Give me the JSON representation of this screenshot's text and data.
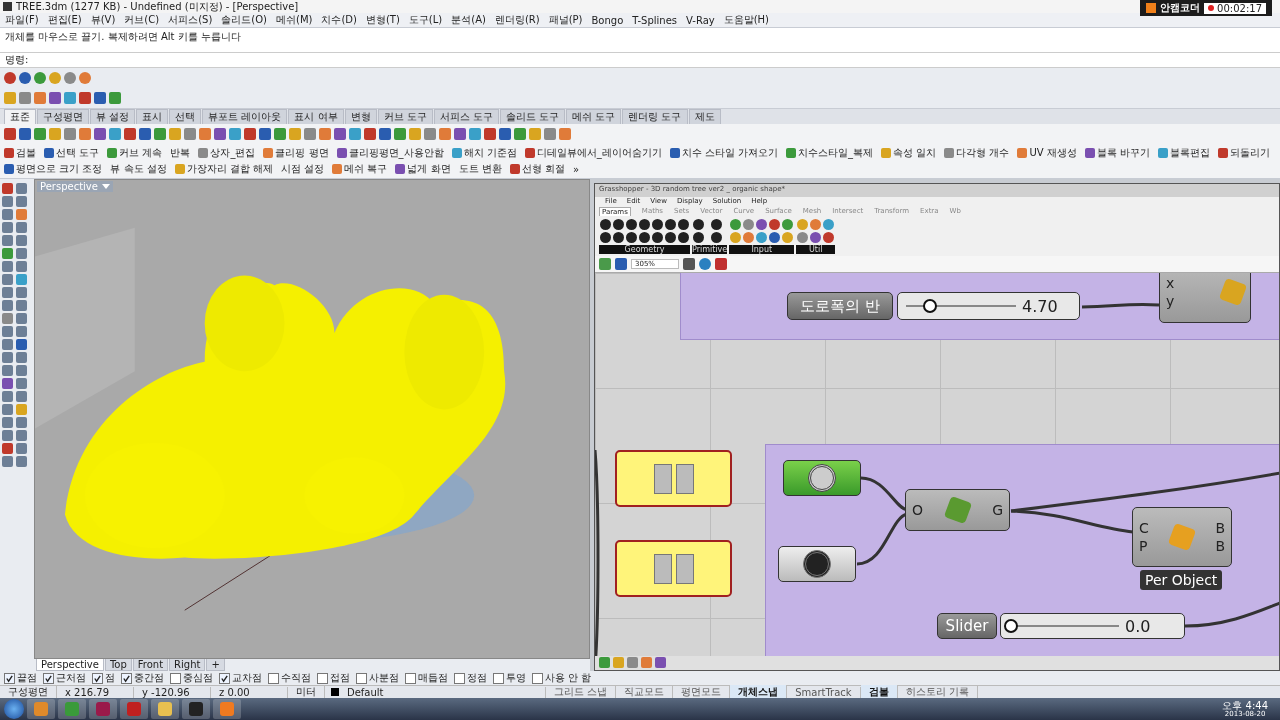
{
  "window": {
    "title": "TREE.3dm (1277 KB) - Undefined (미지정) - [Perspective]"
  },
  "recorder": {
    "name": "안캠코더",
    "time": "00:02:17"
  },
  "menu": [
    "파일(F)",
    "편집(E)",
    "뷰(V)",
    "커브(C)",
    "서피스(S)",
    "솔리드(O)",
    "메쉬(M)",
    "치수(D)",
    "변형(T)",
    "도구(L)",
    "분석(A)",
    "렌더링(R)",
    "패널(P)",
    "Bongo",
    "T-Splines",
    "V-Ray",
    "도움말(H)"
  ],
  "command": {
    "history": "개체를 마우스로 끌기. 복제하려면 Alt 키를 누릅니다",
    "prompt": "명령:"
  },
  "toolbar_tabs": [
    {
      "label": "표준",
      "selected": true
    },
    {
      "label": "구성평면",
      "selected": false
    },
    {
      "label": "뷰 설정",
      "selected": false
    },
    {
      "label": "표시",
      "selected": false
    },
    {
      "label": "선택",
      "selected": false
    },
    {
      "label": "뷰포트 레이아웃",
      "selected": false
    },
    {
      "label": "표시 여부",
      "selected": false
    },
    {
      "label": "변형",
      "selected": false
    },
    {
      "label": "커브 도구",
      "selected": false
    },
    {
      "label": "서피스 도구",
      "selected": false
    },
    {
      "label": "솔리드 도구",
      "selected": false
    },
    {
      "label": "메쉬 도구",
      "selected": false
    },
    {
      "label": "렌더링 도구",
      "selected": false
    },
    {
      "label": "제도",
      "selected": false
    }
  ],
  "tool_buttons": [
    {
      "label": "검볼",
      "icon": true
    },
    {
      "label": "선택 도구",
      "icon": true
    },
    {
      "label": "커브 계속",
      "icon": true
    },
    {
      "label": "반복",
      "icon": false
    },
    {
      "label": "상자_편집",
      "icon": true
    },
    {
      "label": "클리핑 평면",
      "icon": true
    },
    {
      "label": "클리핑평면_사용안함",
      "icon": true
    },
    {
      "label": "해치 기준점",
      "icon": true
    },
    {
      "label": "디테일뷰에서_레이어숨기기",
      "icon": true
    },
    {
      "label": "치수 스타일 가져오기",
      "icon": true
    },
    {
      "label": "치수스타일_복제",
      "icon": true
    },
    {
      "label": "속성 일치",
      "icon": true
    },
    {
      "label": "다각형 개수",
      "icon": true
    },
    {
      "label": "UV 재생성",
      "icon": true
    },
    {
      "label": "블록 바꾸기",
      "icon": true
    },
    {
      "label": "블록편집",
      "icon": true
    },
    {
      "label": "되돌리기",
      "icon": true
    },
    {
      "label": "평면으로 크기 조정",
      "icon": true
    },
    {
      "label": "뷰 속도 설정",
      "icon": false
    },
    {
      "label": "가장자리 결합 해제",
      "icon": true
    },
    {
      "label": "시점 설정",
      "icon": false
    },
    {
      "label": "메쉬 복구",
      "icon": true
    },
    {
      "label": "넓게 화면",
      "icon": true
    },
    {
      "label": "도트 변환",
      "icon": false
    },
    {
      "label": "선형 회절",
      "icon": true
    },
    {
      "label": "»",
      "icon": false
    }
  ],
  "viewport": {
    "label": "Perspective",
    "tabs": [
      {
        "label": "Perspective",
        "selected": true
      },
      {
        "label": "Top",
        "selected": false
      },
      {
        "label": "Front",
        "selected": false
      },
      {
        "label": "Right",
        "selected": false
      },
      {
        "label": "+",
        "selected": false
      }
    ]
  },
  "osnaps": [
    {
      "label": "끝점",
      "checked": true
    },
    {
      "label": "근처점",
      "checked": true
    },
    {
      "label": "점",
      "checked": true
    },
    {
      "label": "중간점",
      "checked": true
    },
    {
      "label": "중심점",
      "checked": false
    },
    {
      "label": "교차점",
      "checked": true
    },
    {
      "label": "수직점",
      "checked": false
    },
    {
      "label": "접점",
      "checked": false
    },
    {
      "label": "사분점",
      "checked": false
    },
    {
      "label": "매듭점",
      "checked": false
    },
    {
      "label": "정점",
      "checked": false
    },
    {
      "label": "투영",
      "checked": false
    },
    {
      "label": "사용 안 함",
      "checked": false
    }
  ],
  "status_bar": {
    "plane": "구성평면",
    "x": "x 216.79",
    "y": "y -120.96",
    "z": "z 0.00",
    "units": "미터",
    "layer": "Default",
    "toggles": [
      {
        "label": "그리드 스냅",
        "on": false
      },
      {
        "label": "직교모드",
        "on": false
      },
      {
        "label": "평면모드",
        "on": false
      },
      {
        "label": "개체스냅",
        "on": true
      },
      {
        "label": "SmartTrack",
        "on": false
      },
      {
        "label": "검볼",
        "on": true
      },
      {
        "label": "히스토리 기록",
        "on": false
      }
    ]
  },
  "grasshopper": {
    "title": "Grasshopper - 3D random tree ver2 _ organic shape*",
    "menu": [
      "File",
      "Edit",
      "View",
      "Display",
      "Solution",
      "Help"
    ],
    "tabs": [
      {
        "label": "Params",
        "selected": true
      },
      {
        "label": "Maths",
        "selected": false
      },
      {
        "label": "Sets",
        "selected": false
      },
      {
        "label": "Vector",
        "selected": false
      },
      {
        "label": "Curve",
        "selected": false
      },
      {
        "label": "Surface",
        "selected": false
      },
      {
        "label": "Mesh",
        "selected": false
      },
      {
        "label": "Intersect",
        "selected": false
      },
      {
        "label": "Transform",
        "selected": false
      },
      {
        "label": "Extra",
        "selected": false
      },
      {
        "label": "Wb",
        "selected": false
      }
    ],
    "panels": [
      "Geometry",
      "Primitive",
      "Input",
      "Util"
    ],
    "zoom": "305%",
    "canvas": {
      "label_panel": "도로폭의 반",
      "slider_top": {
        "value": "4.70",
        "level": 0.2
      },
      "vec_inputs": [
        "x",
        "y"
      ],
      "group_outputs": [
        "O",
        "G"
      ],
      "random_inputs": [
        "C",
        "P"
      ],
      "random_outputs": [
        "B",
        "B"
      ],
      "random_caption": "Per Object",
      "slider_label": "Slider",
      "slider_bottom": {
        "value": "0.0",
        "level": 0
      }
    }
  },
  "taskbar": {
    "time": "오후 4:44",
    "date": "2013-08-20"
  }
}
